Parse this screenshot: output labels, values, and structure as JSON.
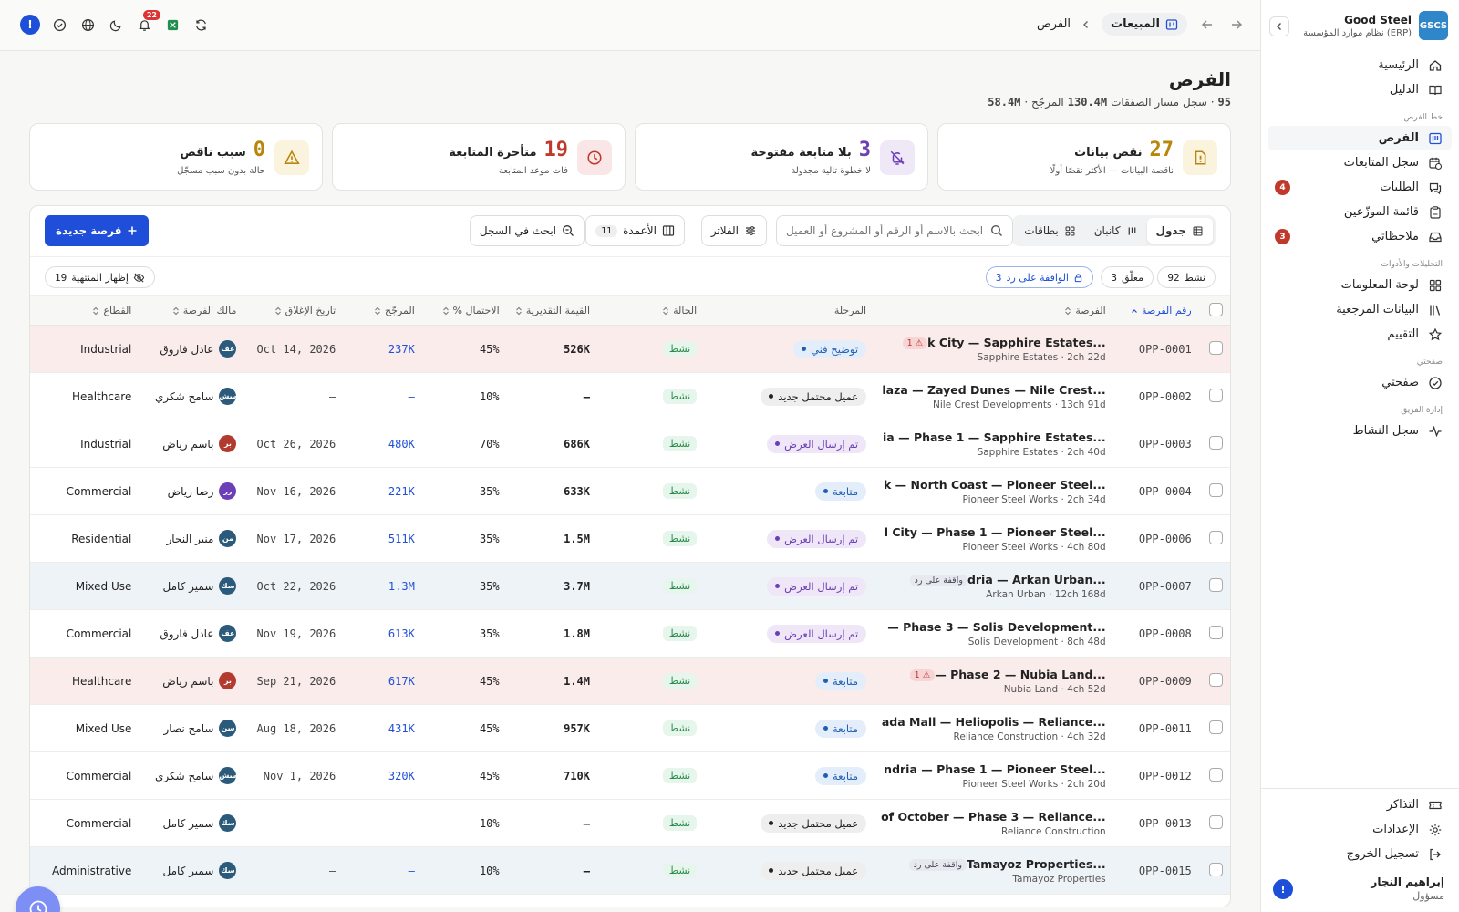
{
  "brand": {
    "name": "Good Steel",
    "subtitle": "نظام موارد المؤسسة (ERP)",
    "logo": "GSCS"
  },
  "nav": {
    "items": [
      {
        "label": "الرئيسية",
        "icon": "home-icon"
      },
      {
        "label": "الدليل",
        "icon": "book-icon"
      }
    ],
    "group1": "خط الفرص",
    "pipeline": [
      {
        "label": "الفرص",
        "icon": "kanban-icon",
        "active": true
      },
      {
        "label": "سجل المتابعات",
        "icon": "calendar-clock-icon"
      },
      {
        "label": "الطلبات",
        "icon": "message-icon",
        "badge": "4"
      },
      {
        "label": "قائمة الموزّعين",
        "icon": "clipboard-icon"
      },
      {
        "label": "ملاحظاتي",
        "icon": "inbox-icon",
        "badge": "3"
      }
    ],
    "group2": "التحليلات والأدوات",
    "analytics": [
      {
        "label": "لوحة المعلومات",
        "icon": "grid-icon"
      },
      {
        "label": "البيانات المرجعية",
        "icon": "library-icon"
      },
      {
        "label": "التقييم",
        "icon": "star-icon"
      }
    ],
    "group3": "صفحتي",
    "mine": [
      {
        "label": "صفحتي",
        "icon": "check-circle-icon"
      }
    ],
    "group4": "إدارة الفريق",
    "team": [
      {
        "label": "سجل النشاط",
        "icon": "activity-icon"
      }
    ],
    "bottom": [
      {
        "label": "التذاكر",
        "icon": "ticket-icon"
      },
      {
        "label": "الإعدادات",
        "icon": "settings-icon"
      },
      {
        "label": "تسجيل الخروج",
        "icon": "logout-icon"
      }
    ]
  },
  "user": {
    "name": "إبراهيم النجار",
    "role": "مسؤول",
    "initial": "!"
  },
  "topbar": {
    "section": "المبيعات",
    "page": "الفرص",
    "notif_count": "22",
    "alert": "!"
  },
  "page": {
    "title": "الفرص",
    "records": "95",
    "records_label": "سجل ·",
    "pipeline_label": "مسار الصفقات",
    "pipeline": "130.4M",
    "weighted_label": "· المرجّح",
    "weighted": "58.4M"
  },
  "kpis": [
    {
      "num": "27",
      "title": "نقص بيانات",
      "sub": "ناقصة البيانات — الأكثر نقصًا أولًا",
      "icon": "alert-file-icon",
      "color": "#b8860b",
      "bg": "#faf3de"
    },
    {
      "num": "3",
      "title": "بلا متابعة مفتوحة",
      "sub": "لا خطوة تالية مجدولة",
      "icon": "bell-off-icon",
      "color": "#6b3fb5",
      "bg": "#efe9f7"
    },
    {
      "num": "19",
      "title": "متأخرة المتابعة",
      "sub": "فات موعد المتابعة",
      "icon": "clock-icon",
      "color": "#c0392b",
      "bg": "#fae6e6"
    },
    {
      "num": "0",
      "title": "سبب ناقص",
      "sub": "حالة بدون سبب مسجّل",
      "icon": "warning-icon",
      "color": "#b8860b",
      "bg": "#faf3de"
    }
  ],
  "toolbar": {
    "views": [
      {
        "label": "جدول",
        "icon": "table-icon",
        "active": true
      },
      {
        "label": "كانبان",
        "icon": "columns-icon"
      },
      {
        "label": "بطاقات",
        "icon": "cards-icon"
      }
    ],
    "search_placeholder": "ابحث بالاسم أو الرقم أو المشروع أو العميل",
    "filter": "الفلاتر",
    "columns": "الأعمدة",
    "columns_count": "11",
    "log_search": "ابحث في السجل",
    "new": "فرصة جديدة"
  },
  "chips": {
    "active_label": "نشط",
    "active": "92",
    "closed_label": "معلّق",
    "closed": "3",
    "awaiting_label": "الواقفة على رد",
    "awaiting": "3",
    "show_closed": "إظهار المنتهية",
    "show_closed_count": "19"
  },
  "columns": [
    "رقم الفرصة",
    "الفرصة",
    "المرحلة",
    "الحالة",
    "القيمة التقديرية",
    "الاحتمال %",
    "المرجّح",
    "تاريخ الإغلاق",
    "مالك الفرصة",
    "القطاع"
  ],
  "rows": [
    {
      "id": "OPP-0001",
      "title": "k City — Sapphire Estates...",
      "sub": "Sapphire Estates · 2ch 22d",
      "tag": "1 ⚠",
      "tagtype": "red",
      "stage": "توضيح فني",
      "sc": "#e3eefa",
      "st": "#1f5fb3",
      "status": "نشط",
      "value": "526K",
      "prob": "45%",
      "weighted": "237K",
      "close": "Oct 14, 2026",
      "owner": "عادل فاروق",
      "ini": "عف",
      "avc": "#2b5a7a",
      "sector": "Industrial",
      "hl": "warn"
    },
    {
      "id": "OPP-0002",
      "title": "laza — Zayed Dunes — Nile Crest...",
      "sub": "Nile Crest Developments · 13ch 91d",
      "tag": "",
      "tagtype": "",
      "stage": "عميل محتمل جديد",
      "sc": "#eeeeee",
      "st": "#222",
      "status": "نشط",
      "value": "—",
      "prob": "10%",
      "weighted": "—",
      "close": "—",
      "owner": "سامح شكري",
      "ini": "سش",
      "avc": "#2b5a7a",
      "sector": "Healthcare",
      "hl": ""
    },
    {
      "id": "OPP-0003",
      "title": "ia — Phase 1 — Sapphire Estates...",
      "sub": "Sapphire Estates · 2ch 40d",
      "tag": "",
      "tagtype": "",
      "stage": "تم إرسال العرض",
      "sc": "#efe6f7",
      "st": "#6b3fb5",
      "status": "نشط",
      "value": "686K",
      "prob": "70%",
      "weighted": "480K",
      "close": "Oct 26, 2026",
      "owner": "باسم رياض",
      "ini": "بر",
      "avc": "#b23a2e",
      "sector": "Industrial",
      "hl": ""
    },
    {
      "id": "OPP-0004",
      "title": "k — North Coast — Pioneer Steel...",
      "sub": "Pioneer Steel Works · 2ch 34d",
      "tag": "",
      "tagtype": "",
      "stage": "متابعة",
      "sc": "#e3eefa",
      "st": "#1f5fb3",
      "status": "نشط",
      "value": "633K",
      "prob": "35%",
      "weighted": "221K",
      "close": "Nov 16, 2026",
      "owner": "رضا رياض",
      "ini": "رر",
      "avc": "#6b3fb5",
      "sector": "Commercial",
      "hl": ""
    },
    {
      "id": "OPP-0006",
      "title": "l City — Phase 1 — Pioneer Steel...",
      "sub": "Pioneer Steel Works · 4ch 80d",
      "tag": "",
      "tagtype": "",
      "stage": "تم إرسال العرض",
      "sc": "#efe6f7",
      "st": "#6b3fb5",
      "status": "نشط",
      "value": "1.5M",
      "prob": "35%",
      "weighted": "511K",
      "close": "Nov 17, 2026",
      "owner": "منير النجار",
      "ini": "من",
      "avc": "#2b5a7a",
      "sector": "Residential",
      "hl": ""
    },
    {
      "id": "OPP-0007",
      "title": "dria — Arkan Urban...",
      "sub": "Arkan Urban · 12ch 168d",
      "tag": "واقفة على رد",
      "tagtype": "grey",
      "stage": "تم إرسال العرض",
      "sc": "#efe6f7",
      "st": "#6b3fb5",
      "status": "نشط",
      "value": "3.7M",
      "prob": "35%",
      "weighted": "1.3M",
      "close": "Oct 22, 2026",
      "owner": "سمير كامل",
      "ini": "سك",
      "avc": "#2b5a7a",
      "sector": "Mixed Use",
      "hl": "info"
    },
    {
      "id": "OPP-0008",
      "title": "— Phase 3 — Solis Development...",
      "sub": "Solis Development · 8ch 48d",
      "tag": "",
      "tagtype": "",
      "stage": "تم إرسال العرض",
      "sc": "#efe6f7",
      "st": "#6b3fb5",
      "status": "نشط",
      "value": "1.8M",
      "prob": "35%",
      "weighted": "613K",
      "close": "Nov 19, 2026",
      "owner": "عادل فاروق",
      "ini": "عف",
      "avc": "#2b5a7a",
      "sector": "Commercial",
      "hl": ""
    },
    {
      "id": "OPP-0009",
      "title": "— Phase 2 — Nubia Land...",
      "sub": "Nubia Land · 4ch 52d",
      "tag": "1 ⚠",
      "tagtype": "red",
      "stage": "متابعة",
      "sc": "#e3eefa",
      "st": "#1f5fb3",
      "status": "نشط",
      "value": "1.4M",
      "prob": "45%",
      "weighted": "617K",
      "close": "Sep 21, 2026",
      "owner": "باسم رياض",
      "ini": "بر",
      "avc": "#b23a2e",
      "sector": "Healthcare",
      "hl": "warn"
    },
    {
      "id": "OPP-0011",
      "title": "ada Mall — Heliopolis — Reliance...",
      "sub": "Reliance Construction · 4ch 32d",
      "tag": "",
      "tagtype": "",
      "stage": "متابعة",
      "sc": "#e3eefa",
      "st": "#1f5fb3",
      "status": "نشط",
      "value": "957K",
      "prob": "45%",
      "weighted": "431K",
      "close": "Aug 18, 2026",
      "owner": "سامح نصار",
      "ini": "سن",
      "avc": "#2b5a7a",
      "sector": "Mixed Use",
      "hl": ""
    },
    {
      "id": "OPP-0012",
      "title": "ndria — Phase 1 — Pioneer Steel...",
      "sub": "Pioneer Steel Works · 2ch 20d",
      "tag": "",
      "tagtype": "",
      "stage": "متابعة",
      "sc": "#e3eefa",
      "st": "#1f5fb3",
      "status": "نشط",
      "value": "710K",
      "prob": "45%",
      "weighted": "320K",
      "close": "Nov 1, 2026",
      "owner": "سامح شكري",
      "ini": "سش",
      "avc": "#2b5a7a",
      "sector": "Commercial",
      "hl": ""
    },
    {
      "id": "OPP-0013",
      "title": "of October — Phase 3 — Reliance...",
      "sub": "Reliance Construction",
      "tag": "",
      "tagtype": "",
      "stage": "عميل محتمل جديد",
      "sc": "#eeeeee",
      "st": "#222",
      "status": "نشط",
      "value": "—",
      "prob": "10%",
      "weighted": "—",
      "close": "—",
      "owner": "سمير كامل",
      "ini": "سك",
      "avc": "#2b5a7a",
      "sector": "Commercial",
      "hl": ""
    },
    {
      "id": "OPP-0015",
      "title": "Tamayoz Properties...",
      "sub": "Tamayoz Properties",
      "tag": "واقفة على رد",
      "tagtype": "grey",
      "stage": "عميل محتمل جديد",
      "sc": "#eeeeee",
      "st": "#222",
      "status": "نشط",
      "value": "—",
      "prob": "10%",
      "weighted": "—",
      "close": "—",
      "owner": "سمير كامل",
      "ini": "سك",
      "avc": "#2b5a7a",
      "sector": "Administrative",
      "hl": "info"
    }
  ]
}
